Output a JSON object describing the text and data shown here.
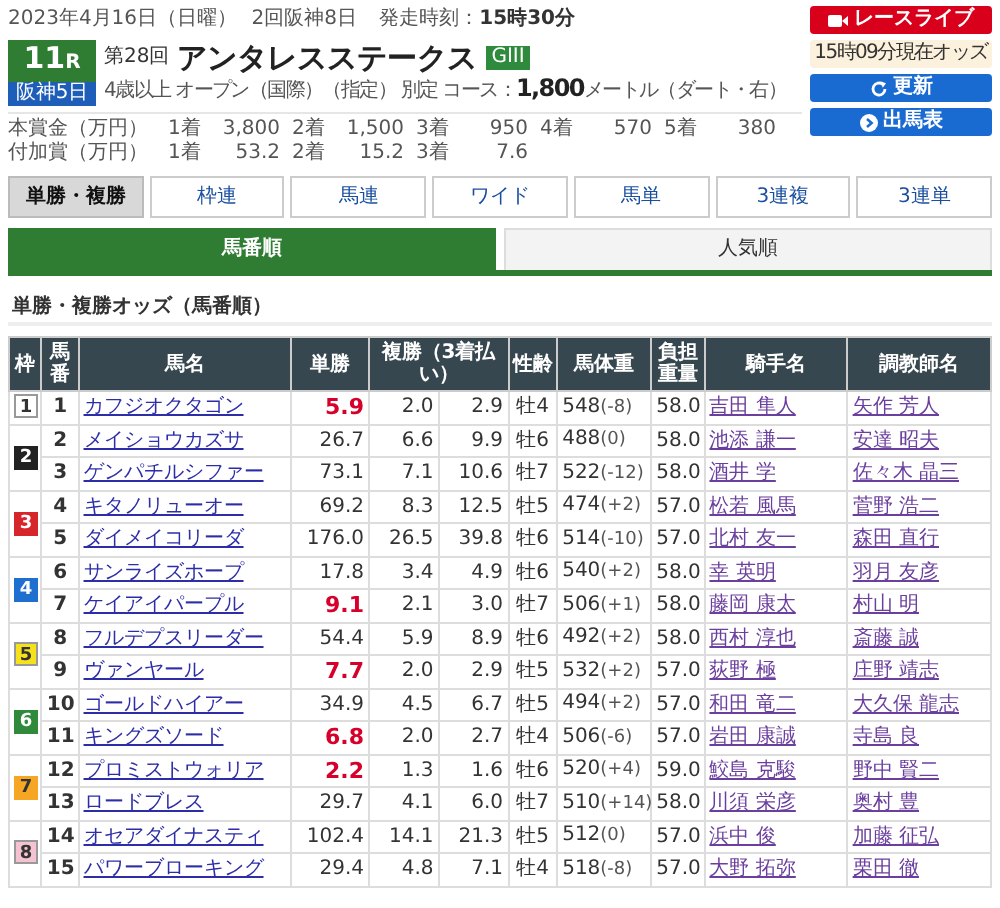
{
  "race_info": {
    "date": "2023年4月16日（日曜）",
    "meeting": "2回阪神8日",
    "post_time_label": "発走時刻：",
    "post_time": "15時30分"
  },
  "race_number": "11",
  "race_unit": "R",
  "course_badge": "阪神5日",
  "edition": "第28回",
  "race_name": "アンタレスステークス",
  "grade": "GIII",
  "conditions": [
    "4歳以上",
    "オープン（国際）（指定）",
    "別定"
  ],
  "course": {
    "label": "コース：",
    "distance": "1,800",
    "unit": "メートル",
    "surface": "（ダート・右）"
  },
  "prizes": [
    {
      "label": "本賞金（万円）",
      "places": [
        {
          "place": "1着",
          "amount": "3,800"
        },
        {
          "place": "2着",
          "amount": "1,500"
        },
        {
          "place": "3着",
          "amount": "950"
        },
        {
          "place": "4着",
          "amount": "570"
        },
        {
          "place": "5着",
          "amount": "380"
        }
      ]
    },
    {
      "label": "付加賞（万円）",
      "places": [
        {
          "place": "1着",
          "amount": "53.2"
        },
        {
          "place": "2着",
          "amount": "15.2"
        },
        {
          "place": "3着",
          "amount": "7.6"
        }
      ]
    }
  ],
  "actions": [
    {
      "kind": "live",
      "label": "レースライブ"
    },
    {
      "kind": "notice",
      "label": "15時09分現在オッズ"
    },
    {
      "kind": "refresh",
      "label": "更新"
    },
    {
      "kind": "entries",
      "label": "出馬表"
    }
  ],
  "bet_tabs": [
    {
      "label": "単勝・複勝",
      "selected": true
    },
    {
      "label": "枠連",
      "selected": false
    },
    {
      "label": "馬連",
      "selected": false
    },
    {
      "label": "ワイド",
      "selected": false
    },
    {
      "label": "馬単",
      "selected": false
    },
    {
      "label": "3連複",
      "selected": false
    },
    {
      "label": "3連単",
      "selected": false
    }
  ],
  "sort_tabs": [
    {
      "label": "馬番順",
      "selected": true
    },
    {
      "label": "人気順",
      "selected": false
    }
  ],
  "section_title": "単勝・複勝オッズ（馬番順）",
  "odds_table": {
    "columns": [
      "枠",
      "馬番",
      "馬名",
      "単勝",
      "複勝（3着払い）",
      "性齢",
      "馬体重",
      "負担重量",
      "騎手名",
      "調教師名"
    ],
    "frames": [
      {
        "number": "1",
        "color": "#ffffff",
        "horses": [
          {
            "number": "1",
            "name": "カフジオクタゴン",
            "win": "5.9",
            "favored": true,
            "place_min": "2.0",
            "place_max": "2.9",
            "sex_age": "牡4",
            "weight": "548",
            "weight_change": "(-8)",
            "burden": "58.0",
            "jockey": "吉田 隼人",
            "trainer": "矢作 芳人"
          }
        ]
      },
      {
        "number": "2",
        "color": "#222222",
        "horses": [
          {
            "number": "2",
            "name": "メイショウカズサ",
            "win": "26.7",
            "favored": false,
            "place_min": "6.6",
            "place_max": "9.9",
            "sex_age": "牡6",
            "weight": "488",
            "weight_change": "(0)",
            "burden": "58.0",
            "jockey": "池添 謙一",
            "trainer": "安達 昭夫"
          },
          {
            "number": "3",
            "name": "ゲンパチルシファー",
            "win": "73.1",
            "favored": false,
            "place_min": "7.1",
            "place_max": "10.6",
            "sex_age": "牡7",
            "weight": "522",
            "weight_change": "(-12)",
            "burden": "58.0",
            "jockey": "酒井 学",
            "trainer": "佐々木 晶三"
          }
        ]
      },
      {
        "number": "3",
        "color": "#d6262c",
        "horses": [
          {
            "number": "4",
            "name": "キタノリューオー",
            "win": "69.2",
            "favored": false,
            "place_min": "8.3",
            "place_max": "12.5",
            "sex_age": "牡5",
            "weight": "474",
            "weight_change": "(+2)",
            "burden": "57.0",
            "jockey": "松若 風馬",
            "trainer": "菅野 浩二"
          },
          {
            "number": "5",
            "name": "ダイメイコリーダ",
            "win": "176.0",
            "favored": false,
            "place_min": "26.5",
            "place_max": "39.8",
            "sex_age": "牡6",
            "weight": "514",
            "weight_change": "(-10)",
            "burden": "57.0",
            "jockey": "北村 友一",
            "trainer": "森田 直行"
          }
        ]
      },
      {
        "number": "4",
        "color": "#1e6fd0",
        "horses": [
          {
            "number": "6",
            "name": "サンライズホープ",
            "win": "17.8",
            "favored": false,
            "place_min": "3.4",
            "place_max": "4.9",
            "sex_age": "牡6",
            "weight": "540",
            "weight_change": "(+2)",
            "burden": "58.0",
            "jockey": "幸 英明",
            "trainer": "羽月 友彦"
          },
          {
            "number": "7",
            "name": "ケイアイパープル",
            "win": "9.1",
            "favored": true,
            "place_min": "2.1",
            "place_max": "3.0",
            "sex_age": "牡7",
            "weight": "506",
            "weight_change": "(+1)",
            "burden": "58.0",
            "jockey": "藤岡 康太",
            "trainer": "村山 明"
          }
        ]
      },
      {
        "number": "5",
        "color": "#f5e11c",
        "horses": [
          {
            "number": "8",
            "name": "フルデプスリーダー",
            "win": "54.4",
            "favored": false,
            "place_min": "5.9",
            "place_max": "8.9",
            "sex_age": "牡6",
            "weight": "492",
            "weight_change": "(+2)",
            "burden": "58.0",
            "jockey": "西村 淳也",
            "trainer": "斎藤 誠"
          },
          {
            "number": "9",
            "name": "ヴァンヤール",
            "win": "7.7",
            "favored": true,
            "place_min": "2.0",
            "place_max": "2.9",
            "sex_age": "牡5",
            "weight": "532",
            "weight_change": "(+2)",
            "burden": "57.0",
            "jockey": "荻野 極",
            "trainer": "庄野 靖志"
          }
        ]
      },
      {
        "number": "6",
        "color": "#2f8a3c",
        "horses": [
          {
            "number": "10",
            "name": "ゴールドハイアー",
            "win": "34.9",
            "favored": false,
            "place_min": "4.5",
            "place_max": "6.7",
            "sex_age": "牡5",
            "weight": "494",
            "weight_change": "(+2)",
            "burden": "57.0",
            "jockey": "和田 竜二",
            "trainer": "大久保 龍志"
          },
          {
            "number": "11",
            "name": "キングズソード",
            "win": "6.8",
            "favored": true,
            "place_min": "2.0",
            "place_max": "2.7",
            "sex_age": "牡4",
            "weight": "506",
            "weight_change": "(-6)",
            "burden": "57.0",
            "jockey": "岩田 康誠",
            "trainer": "寺島 良"
          }
        ]
      },
      {
        "number": "7",
        "color": "#f5a623",
        "horses": [
          {
            "number": "12",
            "name": "プロミストウォリア",
            "win": "2.2",
            "favored": true,
            "place_min": "1.3",
            "place_max": "1.6",
            "sex_age": "牡6",
            "weight": "520",
            "weight_change": "(+4)",
            "burden": "59.0",
            "jockey": "鮫島 克駿",
            "trainer": "野中 賢二"
          },
          {
            "number": "13",
            "name": "ロードブレス",
            "win": "29.7",
            "favored": false,
            "place_min": "4.1",
            "place_max": "6.0",
            "sex_age": "牡7",
            "weight": "510",
            "weight_change": "(+14)",
            "burden": "58.0",
            "jockey": "川須 栄彦",
            "trainer": "奥村 豊"
          }
        ]
      },
      {
        "number": "8",
        "color": "#f4c2d0",
        "horses": [
          {
            "number": "14",
            "name": "オセアダイナスティ",
            "win": "102.4",
            "favored": false,
            "place_min": "14.1",
            "place_max": "21.3",
            "sex_age": "牡5",
            "weight": "512",
            "weight_change": "(0)",
            "burden": "57.0",
            "jockey": "浜中 俊",
            "trainer": "加藤 征弘"
          },
          {
            "number": "15",
            "name": "パワーブローキング",
            "win": "29.4",
            "favored": false,
            "place_min": "4.8",
            "place_max": "7.1",
            "sex_age": "牡4",
            "weight": "518",
            "weight_change": "(-8)",
            "burden": "57.0",
            "jockey": "大野 拓弥",
            "trainer": "栗田 徹"
          }
        ]
      }
    ]
  }
}
